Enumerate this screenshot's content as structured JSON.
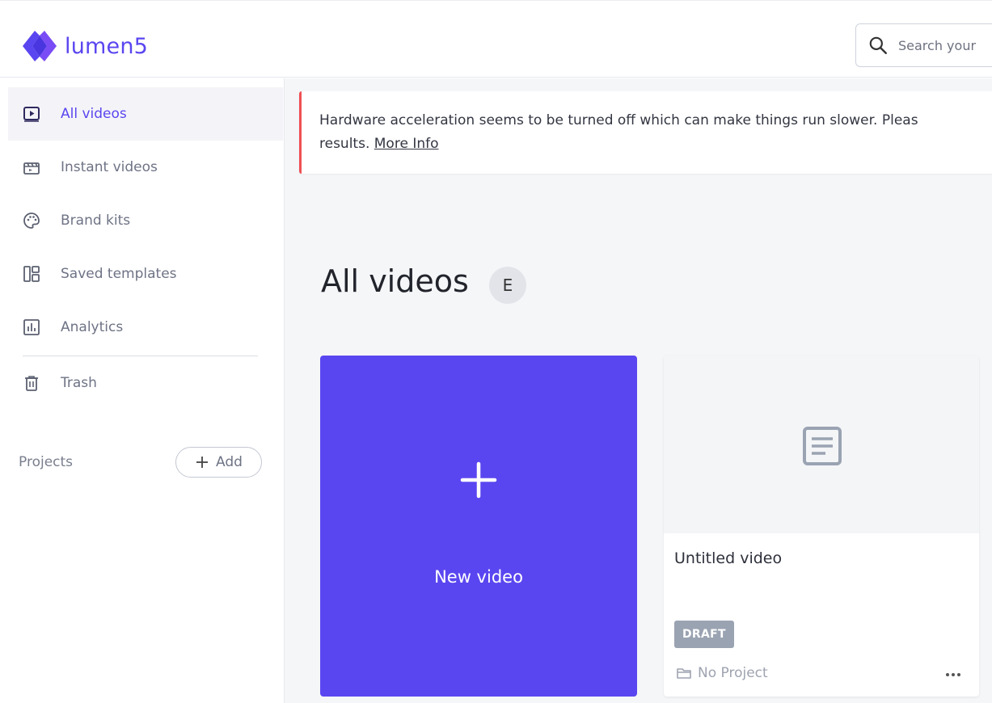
{
  "brand": {
    "name": "lumen5",
    "color": "#5a46f0"
  },
  "search": {
    "placeholder": "Search your"
  },
  "sidebar": {
    "items": [
      {
        "label": "All videos",
        "icon": "play-icon",
        "active": true
      },
      {
        "label": "Instant videos",
        "icon": "clapperboard-icon",
        "active": false
      },
      {
        "label": "Brand kits",
        "icon": "palette-icon",
        "active": false
      },
      {
        "label": "Saved templates",
        "icon": "layout-icon",
        "active": false
      },
      {
        "label": "Analytics",
        "icon": "bar-chart-icon",
        "active": false
      },
      {
        "label": "Trash",
        "icon": "trash-icon",
        "active": false
      }
    ],
    "projects_label": "Projects",
    "add_label": "Add"
  },
  "banner": {
    "text_line1": "Hardware acceleration seems to be turned off which can make things run slower. Pleas",
    "text_line2": "results.",
    "link_label": "More Info",
    "accent_color": "#ef4f54"
  },
  "main": {
    "title": "All videos",
    "badge": "E"
  },
  "new_video": {
    "label": "New video"
  },
  "videos": [
    {
      "title": "Untitled video",
      "status": "DRAFT",
      "project": "No Project"
    }
  ]
}
